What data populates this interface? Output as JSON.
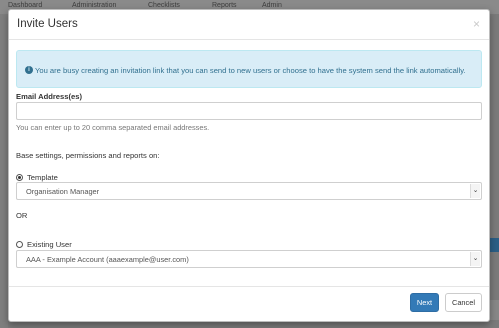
{
  "background": {
    "nav_items": [
      "Dashboard",
      "Administration",
      "Checklists",
      "Reports",
      "Admin"
    ]
  },
  "modal": {
    "title": "Invite Users",
    "close_glyph": "×",
    "info": {
      "icon_glyph": "i",
      "text": "You are busy creating an invitation link that you can send to new users or choose to have the system send the link automatically."
    },
    "email": {
      "label": "Email Address(es)",
      "value": "",
      "placeholder": "",
      "help": "You can enter up to 20 comma separated email addresses."
    },
    "base_settings_text": "Base settings, permissions and reports on:",
    "template_option": {
      "label": "Template",
      "checked": true,
      "selected_value": "Organisation Manager"
    },
    "or_text": "OR",
    "existing_user_option": {
      "label": "Existing User",
      "checked": false,
      "selected_value": "AAA - Example Account (aaaexample@user.com)"
    },
    "buttons": {
      "next": "Next",
      "cancel": "Cancel"
    }
  },
  "colors": {
    "info_bg": "#d9edf7",
    "info_text": "#31708f",
    "primary": "#337ab7"
  }
}
